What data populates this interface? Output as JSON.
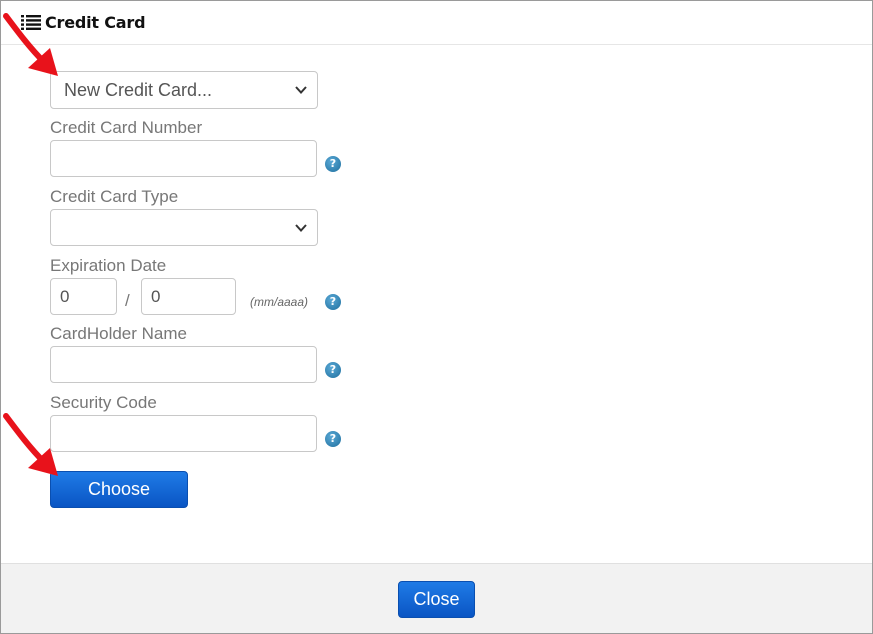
{
  "dialog": {
    "title": "Credit Card",
    "title_icon": "list-icon"
  },
  "form": {
    "card_select": {
      "selected": "New Credit Card..."
    },
    "card_number": {
      "label": "Credit Card Number",
      "value": ""
    },
    "card_type": {
      "label": "Credit Card Type",
      "selected": ""
    },
    "expiration": {
      "label": "Expiration Date",
      "month": "0",
      "separator": "/",
      "year": "0",
      "format_hint": "(mm/aaaa)"
    },
    "cardholder": {
      "label": "CardHolder Name",
      "value": ""
    },
    "security_code": {
      "label": "Security Code",
      "value": ""
    },
    "help_glyph": "?",
    "choose_label": "Choose"
  },
  "footer": {
    "close_label": "Close"
  },
  "colors": {
    "primary_button": "#0a55c4",
    "help_icon": "#1f6f9e",
    "annotation_arrow": "#e8121b"
  }
}
